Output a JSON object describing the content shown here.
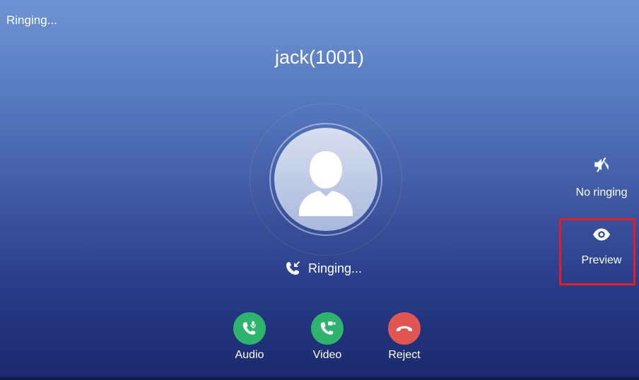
{
  "status_bar": {
    "text": "Ringing..."
  },
  "caller": {
    "name": "jack(1001)"
  },
  "call_status": {
    "text": "Ringing...",
    "icon": "incoming-call-icon"
  },
  "actions": [
    {
      "label": "Audio",
      "icon": "audio-answer-icon",
      "color": "#2eb46e"
    },
    {
      "label": "Video",
      "icon": "video-answer-icon",
      "color": "#2eb46e"
    },
    {
      "label": "Reject",
      "icon": "hang-up-icon",
      "color": "#e05752"
    }
  ],
  "side_actions": [
    {
      "label": "No ringing",
      "icon": "speaker-muted-icon"
    },
    {
      "label": "Preview",
      "icon": "eye-icon"
    }
  ],
  "annotation": {
    "highlight_color": "#e41e26",
    "highlights": "Preview"
  }
}
